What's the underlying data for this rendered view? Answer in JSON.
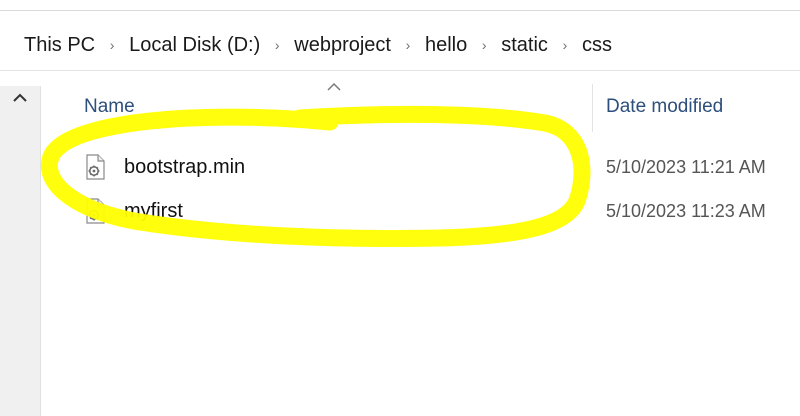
{
  "breadcrumb": {
    "items": [
      "This PC",
      "Local Disk (D:)",
      "webproject",
      "hello",
      "static",
      "css"
    ],
    "separator": "›"
  },
  "columns": {
    "name": "Name",
    "date_modified": "Date modified"
  },
  "files": [
    {
      "name": "bootstrap.min",
      "date": "5/10/2023 11:21 AM",
      "icon": "settings-file-icon"
    },
    {
      "name": "myfirst",
      "date": "5/10/2023 11:23 AM",
      "icon": "settings-file-icon"
    }
  ],
  "colors": {
    "highlight": "#ffff00",
    "header_text": "#2d4f7c"
  }
}
